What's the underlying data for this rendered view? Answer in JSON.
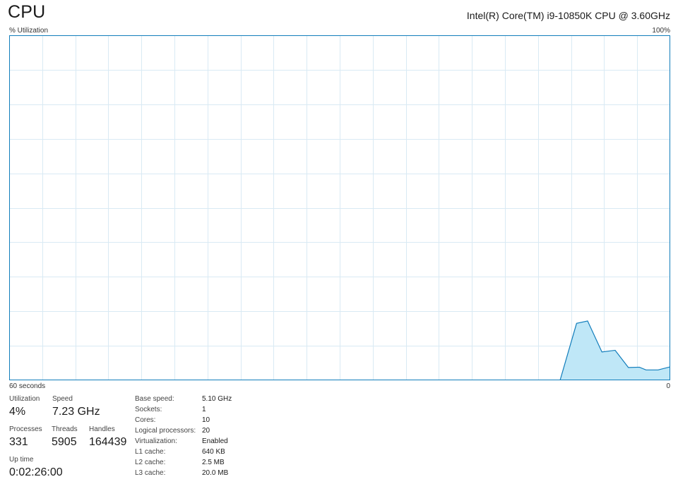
{
  "header": {
    "title": "CPU",
    "cpu_model": "Intel(R) Core(TM) i9-10850K CPU @ 3.60GHz"
  },
  "graph": {
    "y_axis_label": "% Utilization",
    "y_max_label": "100%",
    "x_left_label": "60 seconds",
    "x_right_label": "0",
    "line_color": "#117dbb",
    "fill_color": "#bfe7f7",
    "grid_color": "#d9eaf4",
    "border_color": "#117dbb"
  },
  "chart_data": {
    "type": "area",
    "title": "",
    "xlabel": "",
    "ylabel": "% Utilization",
    "xlim": [
      60,
      0
    ],
    "ylim": [
      0,
      100
    ],
    "grid": true,
    "x": [
      60,
      10,
      8.5,
      7.5,
      6.2,
      5,
      3.8,
      2.8,
      2.2,
      1.1,
      0
    ],
    "series": [
      {
        "values": [
          0,
          0,
          16.5,
          17.2,
          8.2,
          8.7,
          3.7,
          3.8,
          3.0,
          3.0,
          3.9
        ]
      }
    ]
  },
  "stats": {
    "utilization": {
      "label": "Utilization",
      "value": "4%"
    },
    "speed": {
      "label": "Speed",
      "value": "7.23 GHz"
    },
    "processes": {
      "label": "Processes",
      "value": "331"
    },
    "threads": {
      "label": "Threads",
      "value": "5905"
    },
    "handles": {
      "label": "Handles",
      "value": "164439"
    },
    "uptime": {
      "label": "Up time",
      "value": "0:02:26:00"
    }
  },
  "details": [
    {
      "key": "Base speed:",
      "value": "5.10 GHz"
    },
    {
      "key": "Sockets:",
      "value": "1"
    },
    {
      "key": "Cores:",
      "value": "10"
    },
    {
      "key": "Logical processors:",
      "value": "20"
    },
    {
      "key": "Virtualization:",
      "value": "Enabled"
    },
    {
      "key": "L1 cache:",
      "value": "640 KB"
    },
    {
      "key": "L2 cache:",
      "value": "2.5 MB"
    },
    {
      "key": "L3 cache:",
      "value": "20.0 MB"
    }
  ]
}
